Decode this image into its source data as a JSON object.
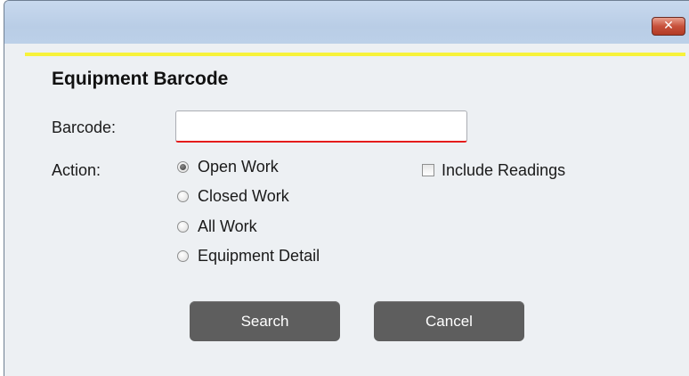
{
  "window": {
    "close_glyph": "✕"
  },
  "dialog": {
    "title": "Equipment Barcode",
    "accent_color": "#f7f23a"
  },
  "barcode": {
    "label": "Barcode:",
    "value": "",
    "placeholder": ""
  },
  "action": {
    "label": "Action:",
    "options": [
      {
        "label": "Open Work",
        "checked": true
      },
      {
        "label": "Closed Work",
        "checked": false
      },
      {
        "label": "All Work",
        "checked": false
      },
      {
        "label": "Equipment Detail",
        "checked": false
      }
    ],
    "include_readings": {
      "label": "Include Readings",
      "checked": false
    }
  },
  "buttons": {
    "search": "Search",
    "cancel": "Cancel"
  }
}
